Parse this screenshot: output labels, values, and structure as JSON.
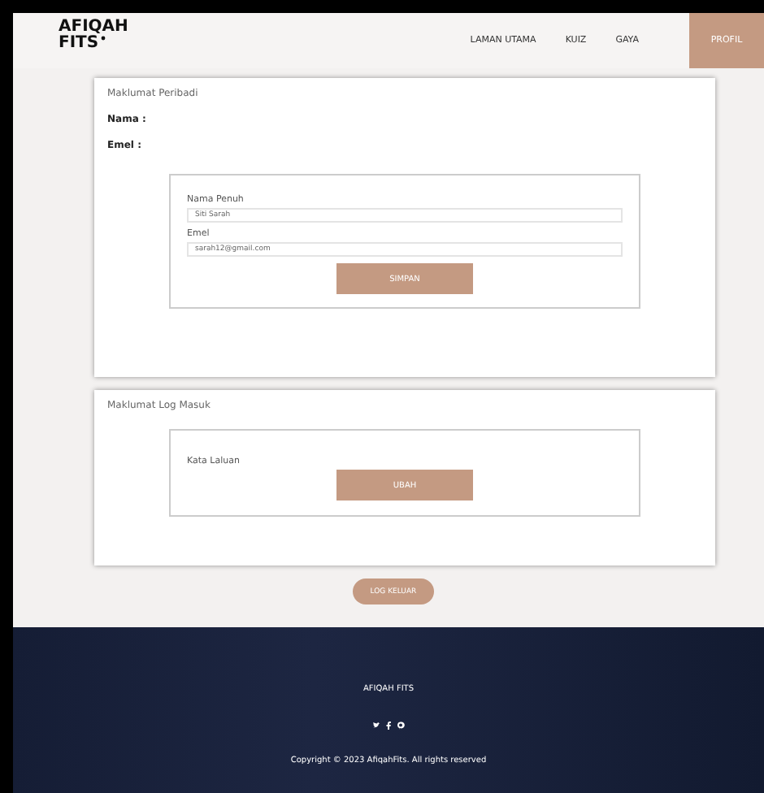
{
  "logo": {
    "line_1": "AFIQAH",
    "line_2": "FITS"
  },
  "nav": [
    {
      "label": "LAMAN UTAMA",
      "selected": false
    },
    {
      "label": "KUIZ",
      "selected": false
    },
    {
      "label": "GAYA",
      "selected": false
    },
    {
      "label": "PROFIL",
      "selected": true
    }
  ],
  "personal": {
    "title": "Maklumat Peribadi",
    "name_label": "Nama :",
    "email_label": "Emel :",
    "form": {
      "fields": [
        {
          "label": "Nama Penuh",
          "value": "Siti Sarah"
        },
        {
          "label": "Emel",
          "value": "sarah12@gmail.com"
        }
      ],
      "button": "SIMPAN"
    }
  },
  "login": {
    "title": "Maklumat Log Masuk",
    "password_label": "Kata Laluan",
    "button": "UBAH"
  },
  "logout_button": "LOG KELUAR",
  "footer": {
    "brand": "AFIQAH FITS",
    "copyright": "Copyright © 2023 AfiqahFits. All rights reserved"
  }
}
